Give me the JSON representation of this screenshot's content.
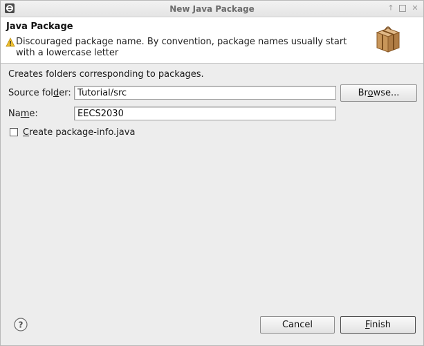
{
  "window": {
    "title": "New Java Package",
    "controls": [
      "restore",
      "maximize",
      "close"
    ]
  },
  "header": {
    "title": "Java Package",
    "message": "Discouraged package name. By convention, package names usually start with a lowercase letter",
    "message_icon": "warning-icon",
    "banner_icon": "package-icon"
  },
  "body": {
    "description": "Creates folders corresponding to packages.",
    "source_folder": {
      "label_pre": "Source fol",
      "label_mnemonic": "d",
      "label_post": "er:",
      "value": "Tutorial/src",
      "browse_pre": "Br",
      "browse_mnemonic": "o",
      "browse_post": "wse..."
    },
    "name": {
      "label_pre": "Na",
      "label_mnemonic": "m",
      "label_post": "e:",
      "value": "EECS2030"
    },
    "package_info": {
      "label_mnemonic": "C",
      "label_post": "reate package-info.java",
      "checked": false
    }
  },
  "footer": {
    "help_icon": "help-icon",
    "cancel": "Cancel",
    "finish_mnemonic": "F",
    "finish_post": "inish"
  },
  "colors": {
    "warning": "#f2c230",
    "package_brown": "#c8965a"
  }
}
